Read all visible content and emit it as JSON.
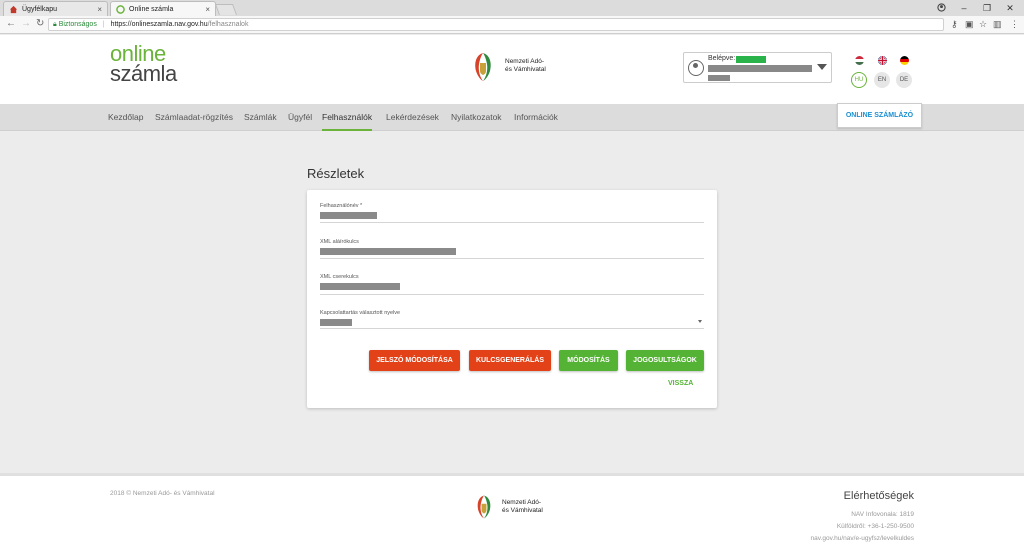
{
  "browser": {
    "tabs": [
      {
        "title": "Ügyfélkapu",
        "close": "×"
      },
      {
        "title": "Online számla",
        "close": "×"
      }
    ],
    "window_controls": {
      "minimize": "–",
      "restore": "❐",
      "close": "✕"
    },
    "secure_label": "Biztonságos",
    "url_host": "https://onlineszamla.nav.gov.hu",
    "url_path": "/felhasznalok"
  },
  "header": {
    "logo_line1": "online",
    "logo_line2": "számla",
    "agency_line1": "Nemzeti Adó-",
    "agency_line2": "és Vámhivatal",
    "user_label": "Belépve:",
    "languages": [
      {
        "code": "HU",
        "active": true
      },
      {
        "code": "EN",
        "active": false
      },
      {
        "code": "DE",
        "active": false
      }
    ]
  },
  "nav": {
    "items": [
      "Kezdőlap",
      "Számlaadat-rögzítés",
      "Számlák",
      "Ügyfél",
      "Felhasználók",
      "Lekérdezések",
      "Nyilatkozatok",
      "Információk"
    ],
    "active_index": 4,
    "szamlazo_button": "ONLINE SZÁMLÁZÓ"
  },
  "details": {
    "title": "Részletek",
    "fields": {
      "username_label": "Felhasználónév *",
      "signing_key_label": "XML aláírókulcs",
      "exchange_key_label": "XML cserekulcs",
      "language_label": "Kapcsolattartás választott nyelve"
    },
    "buttons": {
      "password": "JELSZÓ MÓDOSÍTÁSA",
      "keygen": "KULCSGENERÁLÁS",
      "modify": "MÓDOSÍTÁS",
      "permissions": "JOGOSULTSÁGOK",
      "back": "VISSZA"
    }
  },
  "footer": {
    "copyright": "2018 © Nemzeti Adó- és Vámhivatal",
    "agency_line1": "Nemzeti Adó-",
    "agency_line2": "és Vámhivatal",
    "contact_title": "Elérhetőségek",
    "phone_domestic": "NAV Infovonala: 1819",
    "phone_abroad": "Külföldről: +36-1-250-9500",
    "contact_url": "nav.gov.hu/nav/e-ugyfsz/levelkuldes"
  },
  "colors": {
    "brand_green": "#6bb33b",
    "button_red": "#e34218",
    "button_green": "#54b334",
    "link_blue": "#1a8fd3"
  }
}
